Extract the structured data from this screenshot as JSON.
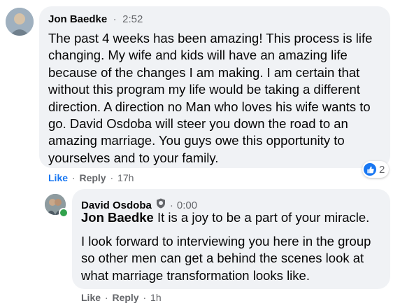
{
  "comment": {
    "author": "Jon Baedke",
    "separator": "·",
    "time": "2:52",
    "text": "The past 4 weeks has been amazing! This process is life changing. My wife and kids will have an amazing life because of the changes I am making. I am certain that without this program my life would be taking a different direction. A direction no Man who loves his wife wants to go. David Osdoba will steer you down the road to an amazing marriage. You guys owe this opportunity to yourselves and to your family.",
    "actions": {
      "like": "Like",
      "reply": "Reply",
      "dot": "·",
      "age": "17h"
    },
    "reactions": {
      "count": "2",
      "icon": "thumbs-up-icon"
    }
  },
  "reply": {
    "author": "David Osdoba",
    "badge_icon": "shield-badge-icon",
    "separator": "·",
    "time": "0:00",
    "mention": "Jon Baedke",
    "text_line1": "It is a joy to be a part of your miracle.",
    "text_paragraph2": "I look forward to interviewing you here in the group so other men can get a behind the scenes look at what marriage transformation looks like.",
    "actions": {
      "like": "Like",
      "reply": "Reply",
      "dot": "·",
      "age": "1h"
    },
    "online": true
  },
  "colors": {
    "bubble": "#f0f2f5",
    "accent": "#1877f2",
    "online": "#31a24c",
    "meta": "#65676b"
  }
}
